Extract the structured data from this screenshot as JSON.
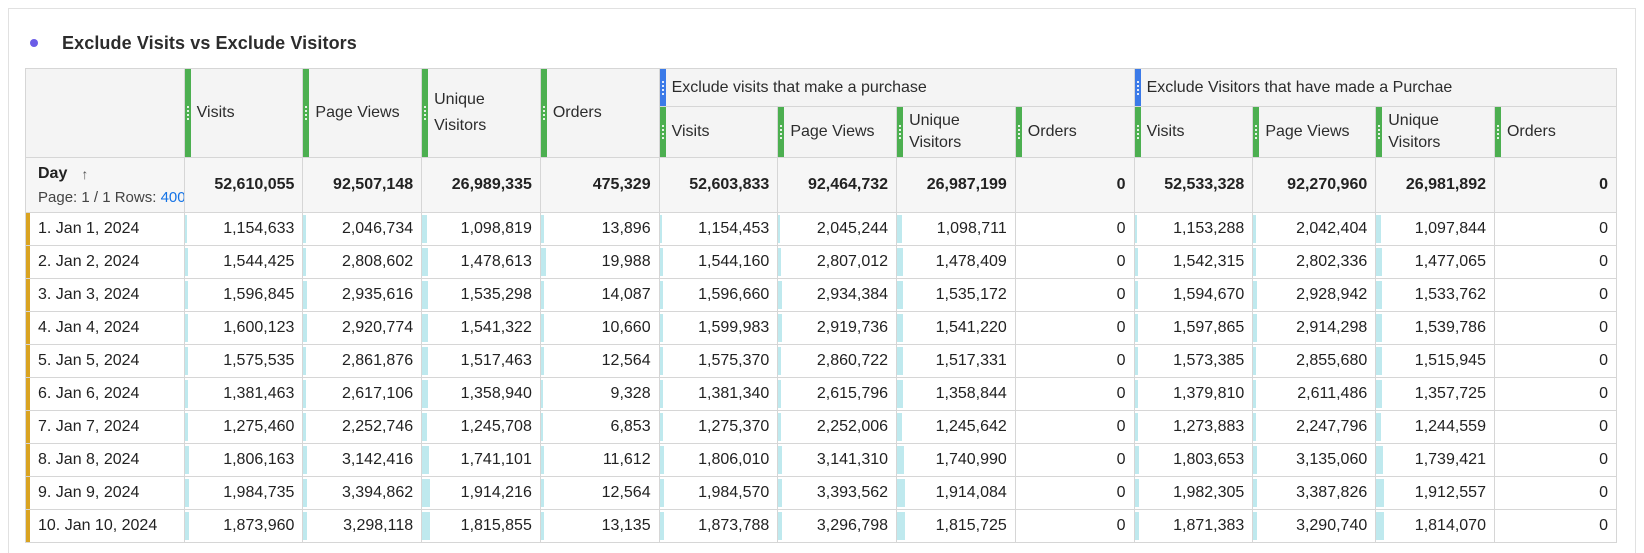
{
  "panel": {
    "title": "Exclude Visits vs Exclude Visitors",
    "accent": "#6b5ce7"
  },
  "headers": {
    "main": [
      "Visits",
      "Page Views",
      "Unique Visitors",
      "Orders"
    ],
    "group1": {
      "title": "Exclude visits that make a purchase",
      "columns": [
        "Visits",
        "Page Views",
        "Unique Visitors",
        "Orders"
      ]
    },
    "group2": {
      "title": "Exclude Visitors that have made a Purchae",
      "columns": [
        "Visits",
        "Page Views",
        "Unique Visitors",
        "Orders"
      ]
    }
  },
  "dimension": {
    "label": "Day",
    "sort_icon": "arrow-up-icon",
    "page_label": "Page: 1 / 1 Rows:",
    "rows_value": "400"
  },
  "totals": [
    "52,610,055",
    "92,507,148",
    "26,989,335",
    "475,329",
    "52,603,833",
    "92,464,732",
    "26,987,199",
    "0",
    "52,533,328",
    "92,270,960",
    "26,981,892",
    "0"
  ],
  "rows": [
    {
      "label": "1.  Jan 1, 2024",
      "values": [
        "1,154,633",
        "2,046,734",
        "1,098,819",
        "13,896",
        "1,154,453",
        "2,045,244",
        "1,098,711",
        "0",
        "1,153,288",
        "2,042,404",
        "1,097,844",
        "0"
      ]
    },
    {
      "label": "2.  Jan 2, 2024",
      "values": [
        "1,544,425",
        "2,808,602",
        "1,478,613",
        "19,988",
        "1,544,160",
        "2,807,012",
        "1,478,409",
        "0",
        "1,542,315",
        "2,802,336",
        "1,477,065",
        "0"
      ]
    },
    {
      "label": "3.  Jan 3, 2024",
      "values": [
        "1,596,845",
        "2,935,616",
        "1,535,298",
        "14,087",
        "1,596,660",
        "2,934,384",
        "1,535,172",
        "0",
        "1,594,670",
        "2,928,942",
        "1,533,762",
        "0"
      ]
    },
    {
      "label": "4.  Jan 4, 2024",
      "values": [
        "1,600,123",
        "2,920,774",
        "1,541,322",
        "10,660",
        "1,599,983",
        "2,919,736",
        "1,541,220",
        "0",
        "1,597,865",
        "2,914,298",
        "1,539,786",
        "0"
      ]
    },
    {
      "label": "5.  Jan 5, 2024",
      "values": [
        "1,575,535",
        "2,861,876",
        "1,517,463",
        "12,564",
        "1,575,370",
        "2,860,722",
        "1,517,331",
        "0",
        "1,573,385",
        "2,855,680",
        "1,515,945",
        "0"
      ]
    },
    {
      "label": "6.  Jan 6, 2024",
      "values": [
        "1,381,463",
        "2,617,106",
        "1,358,940",
        "9,328",
        "1,381,340",
        "2,615,796",
        "1,358,844",
        "0",
        "1,379,810",
        "2,611,486",
        "1,357,725",
        "0"
      ]
    },
    {
      "label": "7.  Jan 7, 2024",
      "values": [
        "1,275,460",
        "2,252,746",
        "1,245,708",
        "6,853",
        "1,275,370",
        "2,252,006",
        "1,245,642",
        "0",
        "1,273,883",
        "2,247,796",
        "1,244,559",
        "0"
      ]
    },
    {
      "label": "8.  Jan 8, 2024",
      "values": [
        "1,806,163",
        "3,142,416",
        "1,741,101",
        "11,612",
        "1,806,010",
        "3,141,310",
        "1,740,990",
        "0",
        "1,803,653",
        "3,135,060",
        "1,739,421",
        "0"
      ]
    },
    {
      "label": "9.  Jan 9, 2024",
      "values": [
        "1,984,735",
        "3,394,862",
        "1,914,216",
        "12,564",
        "1,984,570",
        "3,393,562",
        "1,914,084",
        "0",
        "1,982,305",
        "3,387,826",
        "1,912,557",
        "0"
      ]
    },
    {
      "label": "10.  Jan 10, 2024",
      "values": [
        "1,873,960",
        "3,298,118",
        "1,815,855",
        "13,135",
        "1,873,788",
        "3,296,798",
        "1,815,725",
        "0",
        "1,871,383",
        "3,290,740",
        "1,814,070",
        "0"
      ]
    }
  ]
}
